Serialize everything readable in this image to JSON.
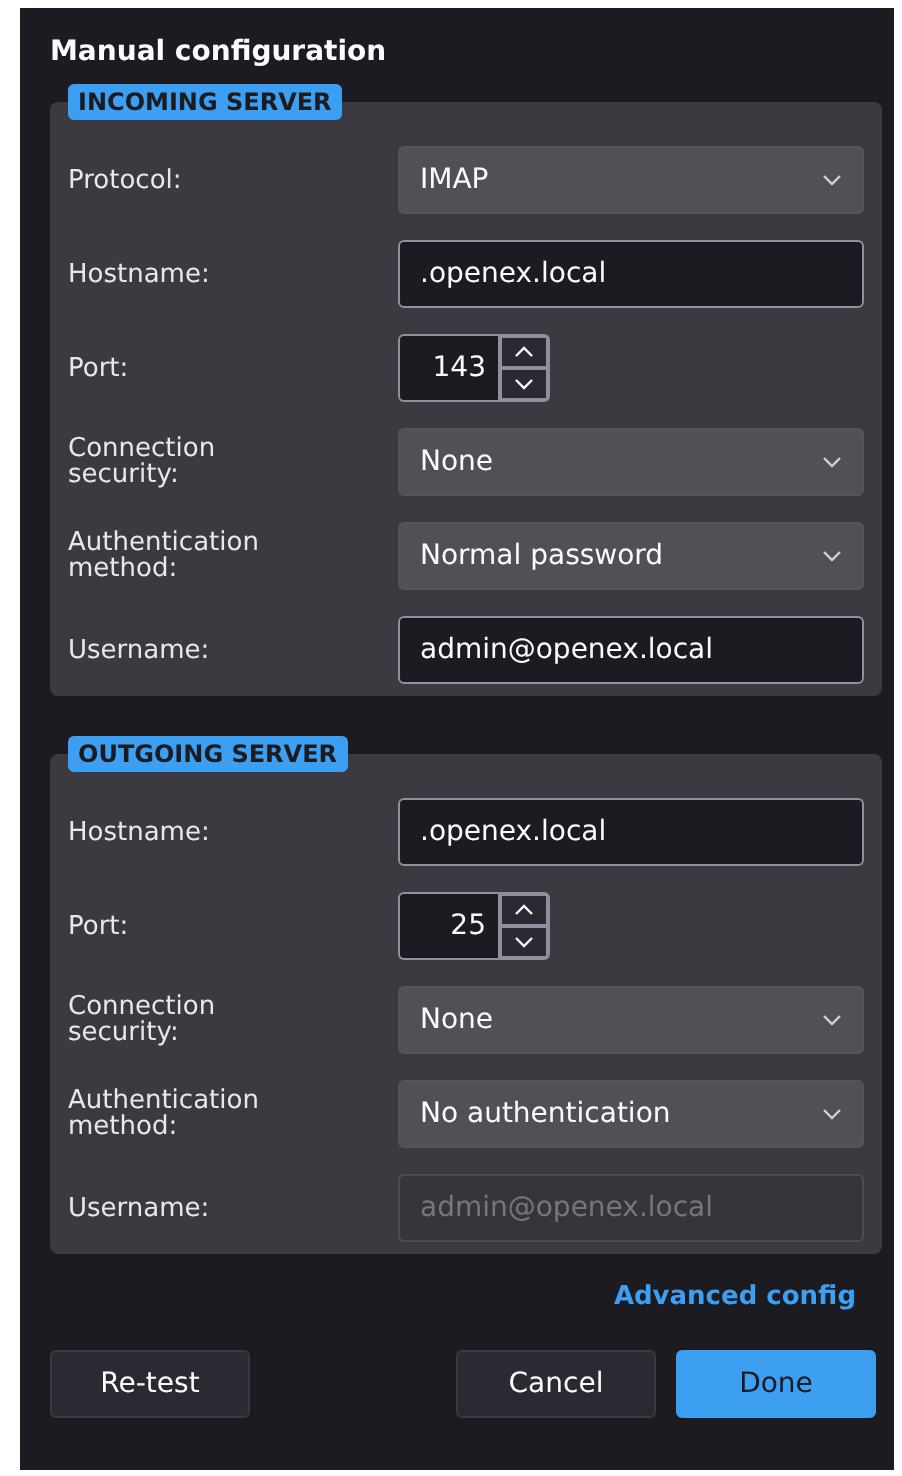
{
  "title": "Manual configuration",
  "sections": [
    {
      "legend": "INCOMING SERVER",
      "rows": [
        {
          "kind": "select",
          "label": "Protocol:",
          "value": "IMAP",
          "disabled": false
        },
        {
          "kind": "text",
          "label": "Hostname:",
          "value": ".openex.local",
          "disabled": false
        },
        {
          "kind": "spin",
          "label": "Port:",
          "value": "143",
          "disabled": false
        },
        {
          "kind": "select",
          "label": "Connection security:",
          "value": "None",
          "disabled": false
        },
        {
          "kind": "select",
          "label": "Authentication method:",
          "value": "Normal password",
          "disabled": false
        },
        {
          "kind": "text",
          "label": "Username:",
          "value": "admin@openex.local",
          "disabled": false
        }
      ]
    },
    {
      "legend": "OUTGOING SERVER",
      "rows": [
        {
          "kind": "text",
          "label": "Hostname:",
          "value": ".openex.local",
          "disabled": false
        },
        {
          "kind": "spin",
          "label": "Port:",
          "value": "25",
          "disabled": false
        },
        {
          "kind": "select",
          "label": "Connection security:",
          "value": "None",
          "disabled": false
        },
        {
          "kind": "select",
          "label": "Authentication method:",
          "value": "No authentication",
          "disabled": false
        },
        {
          "kind": "text",
          "label": "Username:",
          "value": "admin@openex.local",
          "disabled": true
        }
      ]
    }
  ],
  "link": "Advanced config",
  "buttons": [
    {
      "label": "Re-test",
      "kind": "plain"
    },
    {
      "label": "Cancel",
      "kind": "plain"
    },
    {
      "label": "Done",
      "kind": "primary"
    }
  ]
}
